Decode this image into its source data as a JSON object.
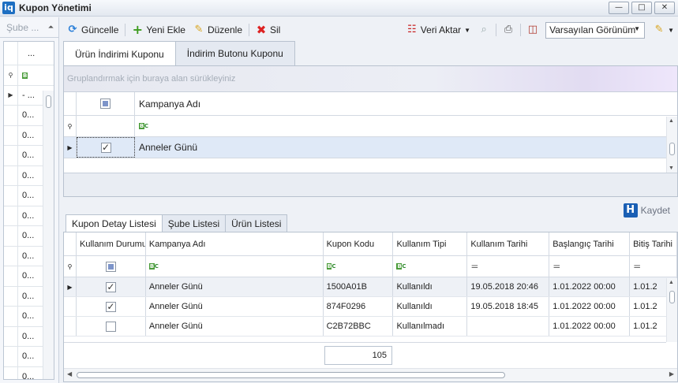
{
  "window": {
    "app_icon": "iq",
    "title": "Kupon Yönetimi",
    "btn_min": "—",
    "btn_max": "□",
    "btn_close": "✕"
  },
  "left_panel": {
    "header": "Şube ...",
    "col_header": "...",
    "first_row": "- ...",
    "rows": [
      "0...",
      "0...",
      "0...",
      "0...",
      "0...",
      "0...",
      "0...",
      "0...",
      "0...",
      "0...",
      "0...",
      "0...",
      "0...",
      "0..."
    ]
  },
  "toolbar": {
    "refresh": "Güncelle",
    "add": "Yeni Ekle",
    "edit": "Düzenle",
    "delete": "Sil",
    "export": "Veri Aktar",
    "view_select": "Varsayılan Görünüm"
  },
  "top_tabs": [
    "Ürün İndirimi Kuponu",
    "İndirim Butonu Kuponu"
  ],
  "upper_grid": {
    "group_hint": "Gruplandırmak için buraya alan sürükleyiniz",
    "column": "Kampanya Adı",
    "row": {
      "checked": true,
      "name": "Anneler Günü"
    }
  },
  "save_label": "Kaydet",
  "lower_tabs": [
    "Kupon Detay Listesi",
    "Şube Listesi",
    "Ürün Listesi"
  ],
  "lower_grid": {
    "columns": [
      "Kullanım Durumu",
      "Kampanya Adı",
      "Kupon Kodu",
      "Kullanım Tipi",
      "Kullanım Tarihi",
      "Başlangıç Tarihi",
      "Bitiş Tarihi"
    ],
    "rows": [
      {
        "used": true,
        "campaign": "Anneler Günü",
        "code": "1500A01B",
        "type": "Kullanıldı",
        "used_date": "19.05.2018 20:46",
        "start": "1.01.2022 00:00",
        "end": "1.01.2"
      },
      {
        "used": true,
        "campaign": "Anneler Günü",
        "code": "874F0296",
        "type": "Kullanıldı",
        "used_date": "19.05.2018 18:45",
        "start": "1.01.2022 00:00",
        "end": "1.01.2"
      },
      {
        "used": false,
        "campaign": "Anneler Günü",
        "code": "C2B72BBC",
        "type": "Kullanılmadı",
        "used_date": "",
        "start": "1.01.2022 00:00",
        "end": "1.01.2"
      }
    ],
    "count": "105"
  }
}
